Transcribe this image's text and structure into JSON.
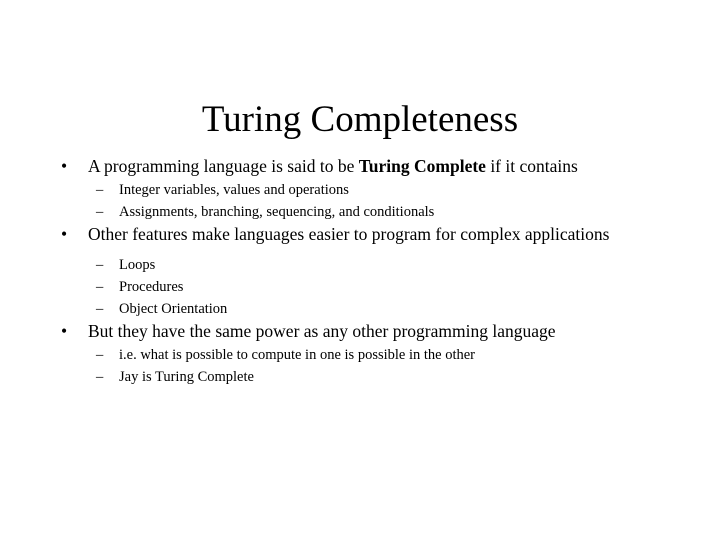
{
  "slide": {
    "title": "Turing Completeness",
    "background_color": "#ffffff",
    "text_color": "#000000",
    "bullet_marker_level1": "•",
    "bullet_marker_level2": "–",
    "groups": [
      {
        "level1": {
          "text_before_bold": "A programming language is said to be ",
          "bold_text": "Turing Complete",
          "text_after_bold": " if it contains"
        },
        "level2": [
          "Integer variables, values and operations",
          "Assignments, branching, sequencing, and conditionals"
        ]
      },
      {
        "level1": {
          "text_before_bold": "Other features make languages easier to program for complex applications",
          "bold_text": "",
          "text_after_bold": ""
        },
        "level2": [
          "Loops",
          "Procedures",
          "Object Orientation"
        ]
      },
      {
        "level1": {
          "text_before_bold": "But they have the same power as any other programming language",
          "bold_text": "",
          "text_after_bold": ""
        },
        "level2": [
          "i.e. what is possible to compute in one is possible in the other",
          "Jay is Turing Complete"
        ]
      }
    ]
  }
}
